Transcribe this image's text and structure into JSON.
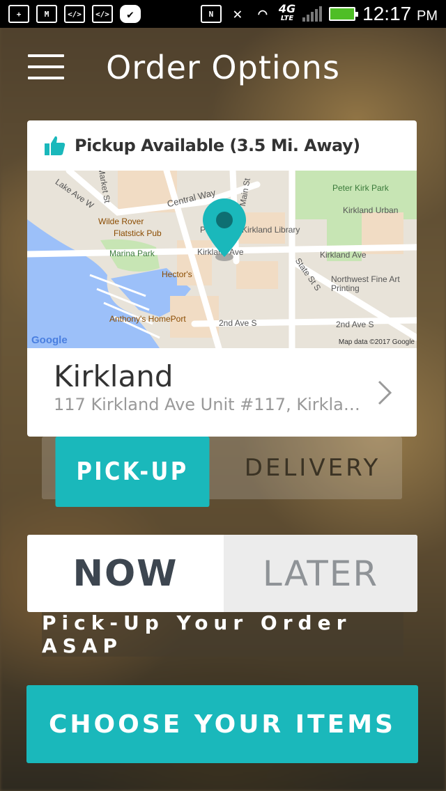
{
  "status_bar": {
    "time": "12:17",
    "ampm": "PM",
    "network": "4G",
    "network_sub": "LTE"
  },
  "header": {
    "title": "Order Options"
  },
  "store_card": {
    "pickup_availability": "Pickup Available (3.5 Mi. Away)",
    "location_name": "Kirkland",
    "location_address": "117 Kirkland Ave Unit #117, Kirkland...",
    "map": {
      "labels": {
        "lake_ave": "Lake Ave W",
        "market_st": "Market St",
        "central_way": "Central Way",
        "main_st": "Main St",
        "peter_kirk_park": "Peter Kirk Park",
        "kirkland_urban": "Kirkland Urban",
        "wilde_rover": "Wilde Rover",
        "flatstick_pub": "Flatstick Pub",
        "park_prefix": "Pa",
        "kirkland_library": "Kirkland Library",
        "marina_park": "Marina Park",
        "kirkland_ave": "Kirkland Ave",
        "kirkland_ave_east": "Kirkland Ave",
        "state_st": "State St S",
        "hectors": "Hector's",
        "northwest_fine_art": "Northwest Fine Art Printing",
        "anthonys": "Anthony's HomePort",
        "second_ave": "2nd Ave S",
        "second_ave_east": "2nd Ave S"
      },
      "google_logo": "Google",
      "credit": "Map data ©2017 Google"
    }
  },
  "fulfillment_toggle": {
    "pickup_label": "PICK-UP",
    "delivery_label": "DELIVERY",
    "selected": "PICK-UP"
  },
  "timing_toggle": {
    "now_label": "NOW",
    "later_label": "LATER",
    "selected": "NOW"
  },
  "timing_note": "Pick-Up Your Order ASAP",
  "cta": {
    "label": "CHOOSE YOUR ITEMS"
  },
  "colors": {
    "accent": "#1ab8bb",
    "text_dark": "#333333",
    "text_muted": "#999999"
  }
}
